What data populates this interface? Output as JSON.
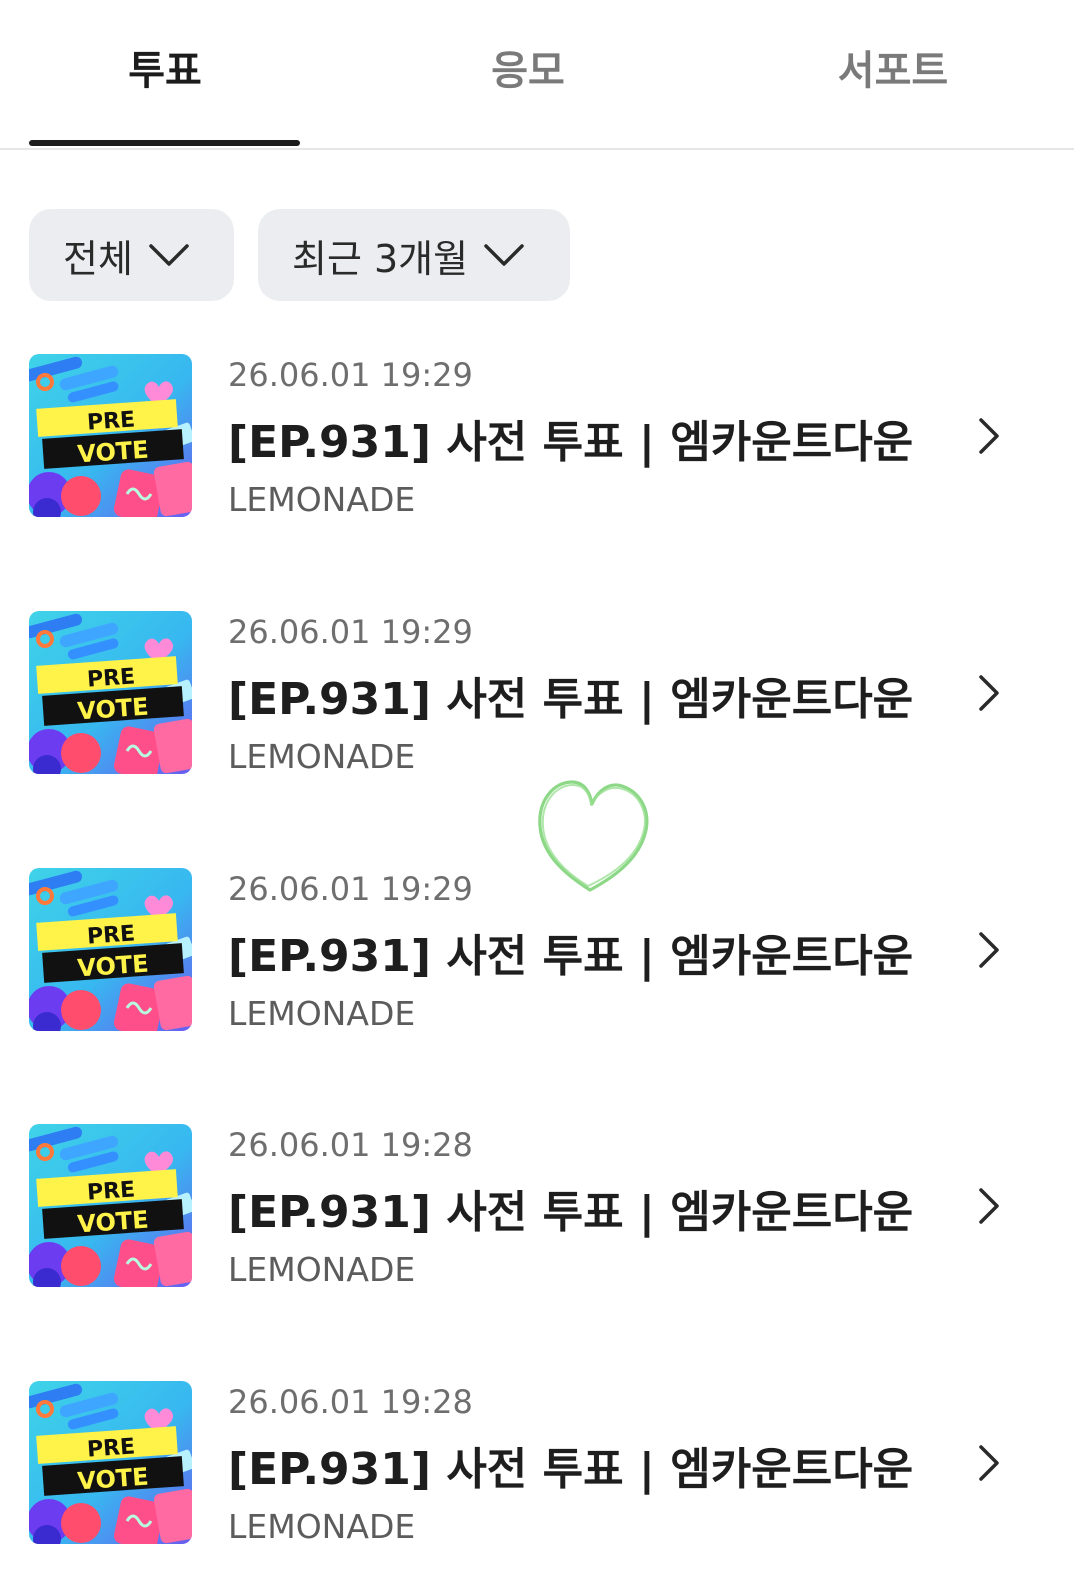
{
  "tabs": [
    {
      "label": "투표",
      "active": true
    },
    {
      "label": "응모",
      "active": false
    },
    {
      "label": "서포트",
      "active": false
    }
  ],
  "filters": {
    "category": "전체",
    "period": "최근 3개월"
  },
  "thumbnail": {
    "line1": "PRE",
    "line2": "VOTE"
  },
  "items": [
    {
      "date": "26.06.01 19:29",
      "title": "[EP.931] 사전 투표 | 엠카운트다운",
      "channel": "LEMONADE"
    },
    {
      "date": "26.06.01 19:29",
      "title": "[EP.931] 사전 투표 | 엠카운트다운",
      "channel": "LEMONADE"
    },
    {
      "date": "26.06.01 19:29",
      "title": "[EP.931] 사전 투표 | 엠카운트다운",
      "channel": "LEMONADE"
    },
    {
      "date": "26.06.01 19:28",
      "title": "[EP.931] 사전 투표 | 엠카운트다운",
      "channel": "LEMONADE"
    },
    {
      "date": "26.06.01 19:28",
      "title": "[EP.931] 사전 투표 | 엠카운트다운",
      "channel": "LEMONADE"
    }
  ],
  "colors": {
    "active_tab": "#1c1c1c",
    "inactive_tab": "#7a7a7a",
    "filter_bg": "#ebedf0",
    "doodle": "#7fd47a"
  }
}
